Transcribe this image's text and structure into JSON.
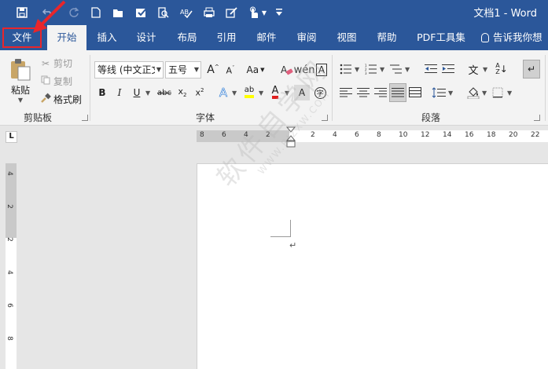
{
  "app": {
    "doc_title": "文档1 - Word"
  },
  "quick_access": [
    "save-icon",
    "undo-icon",
    "redo-icon",
    "new-doc-icon",
    "open-icon",
    "check-icon",
    "print-preview-icon",
    "spell-icon",
    "print-icon",
    "edit-icon",
    "touch-mode-icon",
    "customize-icon"
  ],
  "tabs": {
    "file": "文件",
    "home": "开始",
    "insert": "插入",
    "design": "设计",
    "layout": "布局",
    "references": "引用",
    "mailings": "邮件",
    "review": "审阅",
    "view": "视图",
    "help": "帮助",
    "pdf": "PDF工具集",
    "tell_me": "告诉我你想"
  },
  "clipboard": {
    "paste": "粘贴",
    "cut": "剪切",
    "copy": "复制",
    "format_painter": "格式刷",
    "group_label": "剪贴板"
  },
  "font": {
    "font_name": "等线 (中文正文",
    "font_size": "五号",
    "group_label": "字体"
  },
  "paragraph": {
    "group_label": "段落"
  },
  "ruler": {
    "h_ticks_left": [
      "8",
      "6",
      "4",
      "2"
    ],
    "h_ticks_right": [
      "2",
      "4",
      "6",
      "8",
      "10",
      "12",
      "14",
      "16",
      "18",
      "20",
      "22"
    ],
    "v_ticks": [
      "4",
      "2",
      "2",
      "4",
      "6",
      "8"
    ],
    "tab_selector": "L"
  },
  "document": {
    "paragraph_mark": "↵"
  },
  "watermark": {
    "text": "软件自学网",
    "sub": "WWW.RJZXW.COM"
  }
}
